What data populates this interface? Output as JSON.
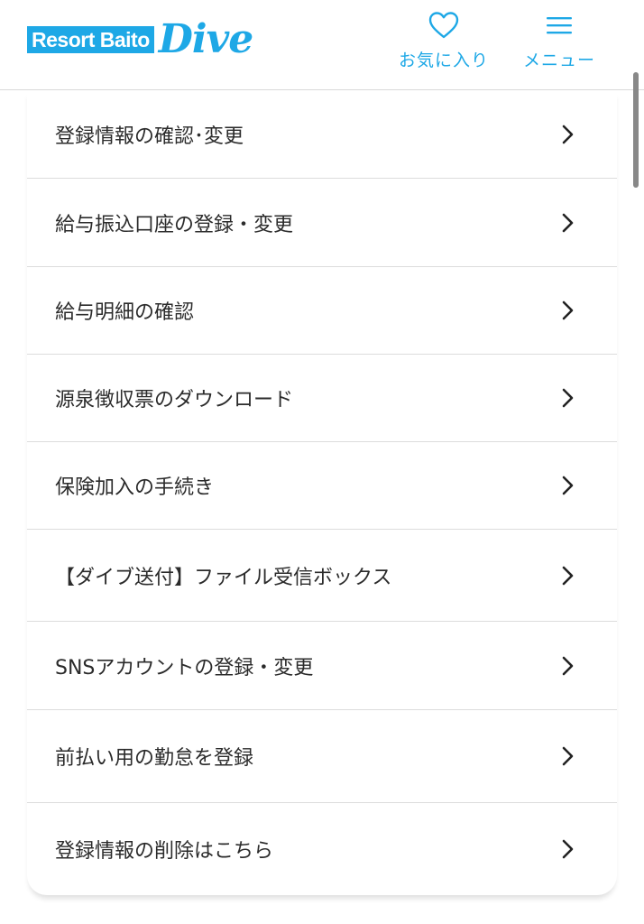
{
  "header": {
    "logo_text": "Resort Baito",
    "logo_script": "Dive",
    "favorites_label": "お気に入り",
    "favorites_icon": "heart-icon",
    "menu_label": "メニュー",
    "menu_icon": "hamburger-icon"
  },
  "colors": {
    "brand": "#1ea8e6",
    "divider": "#dcdcdc",
    "text": "#2b2b2b"
  },
  "menu_items": [
    {
      "label": "登録情報の確認･変更",
      "icon": "chevron-right-icon"
    },
    {
      "label": "給与振込口座の登録・変更",
      "icon": "chevron-right-icon"
    },
    {
      "label": "給与明細の確認",
      "icon": "chevron-right-icon"
    },
    {
      "label": "源泉徴収票のダウンロード",
      "icon": "chevron-right-icon"
    },
    {
      "label": "保険加入の手続き",
      "icon": "chevron-right-icon"
    },
    {
      "label": "【ダイブ送付】ファイル受信ボックス",
      "icon": "chevron-right-icon"
    },
    {
      "label": "SNSアカウントの登録・変更",
      "icon": "chevron-right-icon"
    },
    {
      "label": "前払い用の勤怠を登録",
      "icon": "chevron-right-icon"
    },
    {
      "label": "登録情報の削除はこちら",
      "icon": "chevron-right-icon"
    }
  ]
}
